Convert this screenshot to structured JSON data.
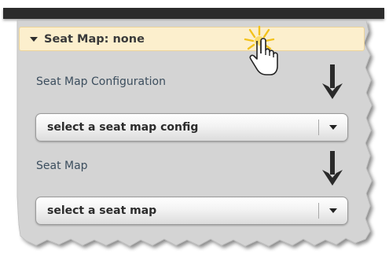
{
  "panel": {
    "header_title": "Seat Map: none"
  },
  "fields": [
    {
      "label": "Seat Map Configuration",
      "select_value": "select a seat map config"
    },
    {
      "label": "Seat Map",
      "select_value": "select a seat map"
    }
  ],
  "icons": {
    "header_caret": "caret-down-icon",
    "cursor": "hand-pointer-click-icon",
    "hint_arrow": "arrow-down-icon",
    "dropdown_arrow": "chevron-down-icon"
  },
  "colors": {
    "header_bg": "#fcefcd",
    "panel_bg": "#d4d4d4",
    "label_text": "#3c4e5e",
    "click_burst": "#f3c21b"
  }
}
